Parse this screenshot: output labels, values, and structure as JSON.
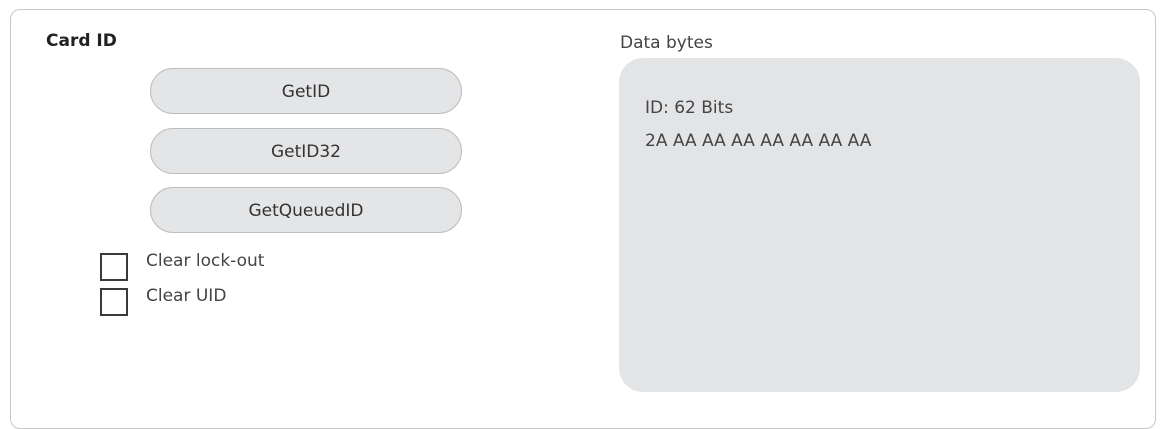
{
  "card_id": {
    "title": "Card ID",
    "buttons": {
      "get_id": "GetID",
      "get_id32": "GetID32",
      "get_queued_id": "GetQueuedID"
    },
    "checkboxes": {
      "clear_lockout": {
        "label": "Clear lock-out",
        "checked": false
      },
      "clear_uid": {
        "label": "Clear UID",
        "checked": false
      }
    }
  },
  "data_bytes": {
    "label": "Data bytes",
    "lines": [
      "ID: 62 Bits",
      "2A AA AA AA AA AA AA AA"
    ]
  }
}
